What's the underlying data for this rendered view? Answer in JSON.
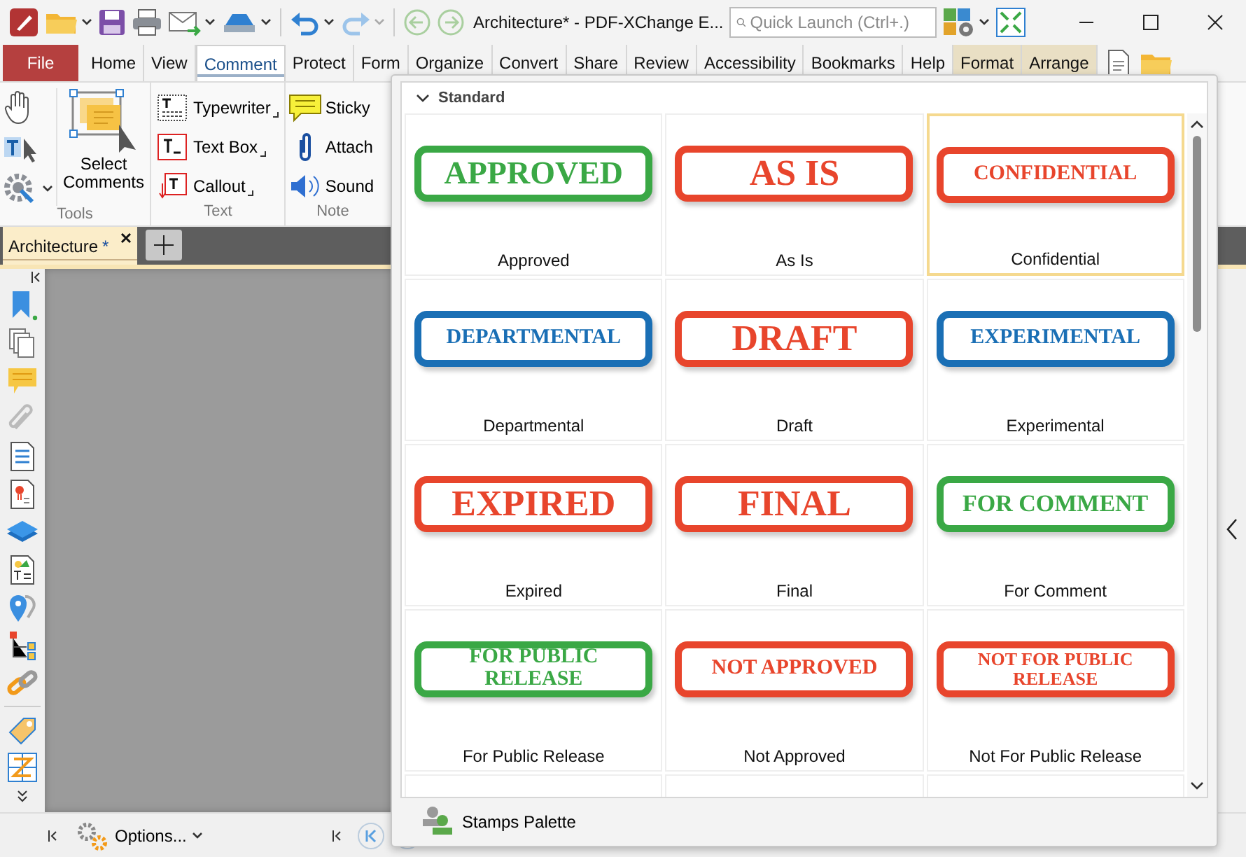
{
  "title_bar": {
    "title": "Architecture* - PDF-XChange E...",
    "search": {
      "placeholder": "Quick Launch (Ctrl+.)"
    }
  },
  "ribbon": {
    "tabs": [
      {
        "label": "File",
        "kind": "file",
        "selected": false,
        "contextual": false
      },
      {
        "label": "Home",
        "kind": "tab",
        "selected": false,
        "contextual": false
      },
      {
        "label": "View",
        "kind": "tab",
        "selected": false,
        "contextual": false
      },
      {
        "label": "Comment",
        "kind": "tab",
        "selected": true,
        "contextual": false
      },
      {
        "label": "Protect",
        "kind": "tab",
        "selected": false,
        "contextual": false
      },
      {
        "label": "Form",
        "kind": "tab",
        "selected": false,
        "contextual": false
      },
      {
        "label": "Organize",
        "kind": "tab",
        "selected": false,
        "contextual": false
      },
      {
        "label": "Convert",
        "kind": "tab",
        "selected": false,
        "contextual": false
      },
      {
        "label": "Share",
        "kind": "tab",
        "selected": false,
        "contextual": false
      },
      {
        "label": "Review",
        "kind": "tab",
        "selected": false,
        "contextual": false
      },
      {
        "label": "Accessibility",
        "kind": "tab",
        "selected": false,
        "contextual": false
      },
      {
        "label": "Bookmarks",
        "kind": "tab",
        "selected": false,
        "contextual": false
      },
      {
        "label": "Help",
        "kind": "tab",
        "selected": false,
        "contextual": false
      },
      {
        "label": "Format",
        "kind": "tab",
        "selected": false,
        "contextual": true
      },
      {
        "label": "Arrange",
        "kind": "tab",
        "selected": false,
        "contextual": true
      }
    ],
    "groups": [
      {
        "label": "Tools",
        "big_button": "Select Comments"
      },
      {
        "label": "Text",
        "items": [
          "Typewriter",
          "Text Box",
          "Callout"
        ]
      },
      {
        "label": "Note",
        "items": [
          "Sticky",
          "Attach",
          "Sound"
        ]
      }
    ]
  },
  "document_tab": {
    "label": "Architecture",
    "modified_mark": "*"
  },
  "stamps_palette": {
    "section": "Standard",
    "footer": "Stamps Palette",
    "stamps": [
      {
        "label": "Approved",
        "lines": [
          "APPROVED"
        ],
        "color": "#3aa845",
        "selected": false
      },
      {
        "label": "As Is",
        "lines": [
          "AS IS"
        ],
        "color": "#e8452c",
        "selected": false
      },
      {
        "label": "Confidential",
        "lines": [
          "CONFIDENTIAL"
        ],
        "color": "#e8452c",
        "selected": true
      },
      {
        "label": "Departmental",
        "lines": [
          "DEPARTMENTAL"
        ],
        "color": "#1a6fb5",
        "selected": false
      },
      {
        "label": "Draft",
        "lines": [
          "DRAFT"
        ],
        "color": "#e8452c",
        "selected": false
      },
      {
        "label": "Experimental",
        "lines": [
          "EXPERIMENTAL"
        ],
        "color": "#1a6fb5",
        "selected": false
      },
      {
        "label": "Expired",
        "lines": [
          "EXPIRED"
        ],
        "color": "#e8452c",
        "selected": false
      },
      {
        "label": "Final",
        "lines": [
          "FINAL"
        ],
        "color": "#e8452c",
        "selected": false
      },
      {
        "label": "For Comment",
        "lines": [
          "FOR COMMENT"
        ],
        "color": "#3aa845",
        "selected": false
      },
      {
        "label": "For Public Release",
        "lines": [
          "FOR PUBLIC",
          "RELEASE"
        ],
        "color": "#3aa845",
        "selected": false
      },
      {
        "label": "Not Approved",
        "lines": [
          "NOT APPROVED"
        ],
        "color": "#e8452c",
        "selected": false
      },
      {
        "label": "Not For Public Release",
        "lines": [
          "NOT FOR PUBLIC",
          "RELEASE"
        ],
        "color": "#e8452c",
        "selected": false
      }
    ]
  },
  "bottom_bar": {
    "options": "Options..."
  }
}
